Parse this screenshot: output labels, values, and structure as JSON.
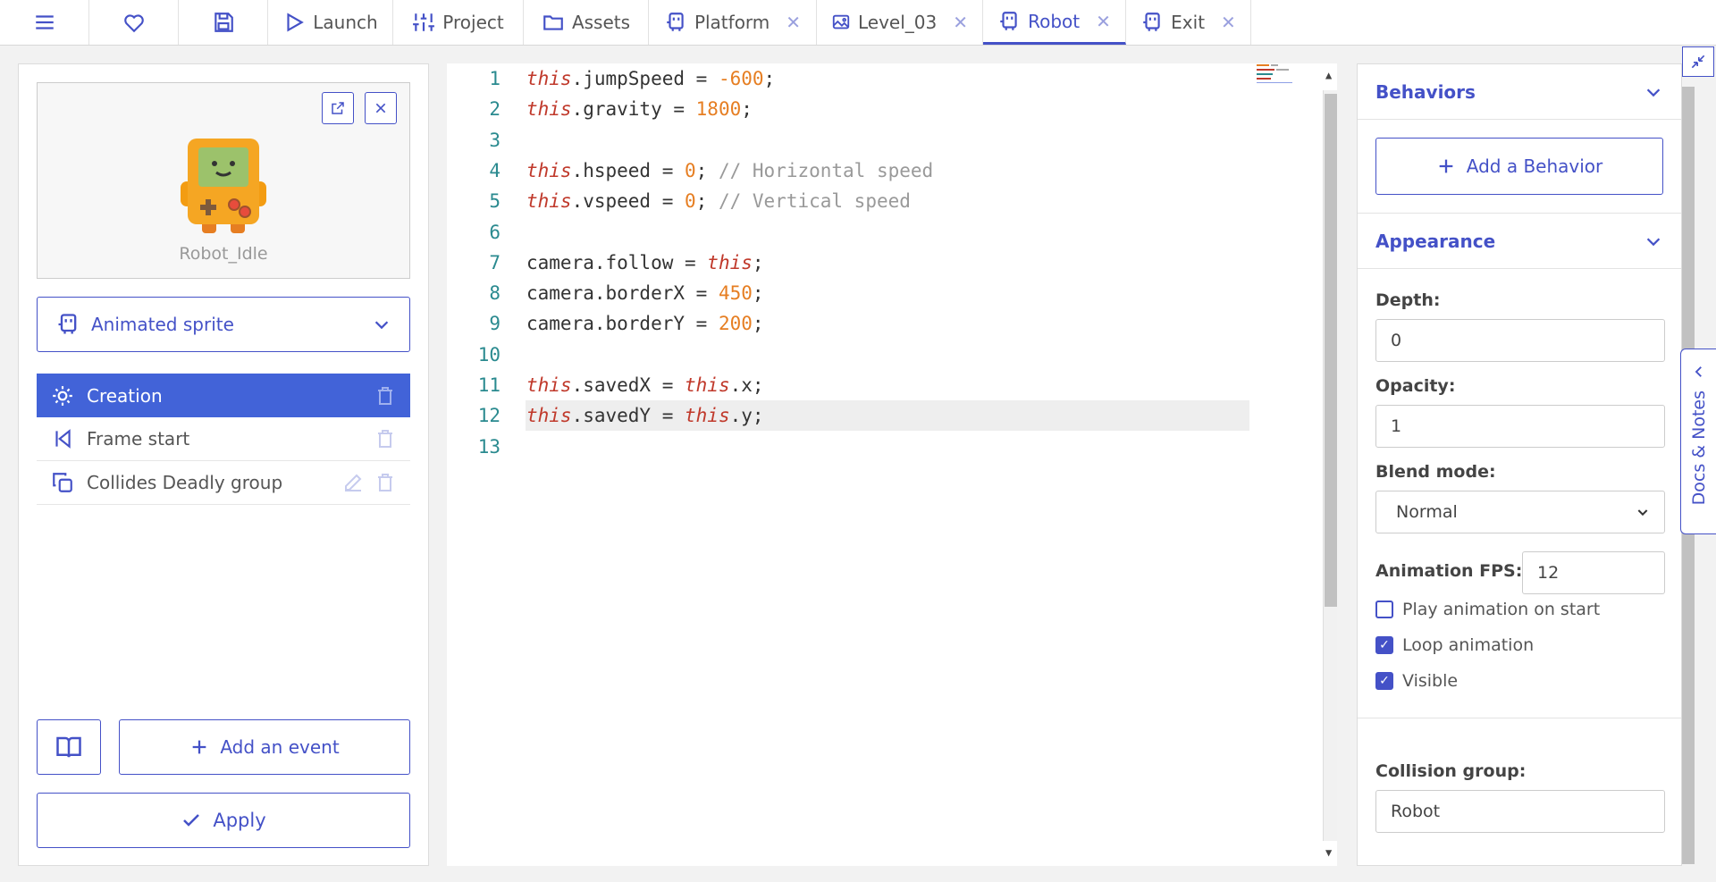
{
  "toolbar": {
    "menu_icon": "hamburger-icon",
    "favorite_icon": "heart-icon",
    "save_icon": "floppy-icon",
    "launch_label": "Launch",
    "project_label": "Project",
    "assets_label": "Assets",
    "tabs": [
      {
        "label": "Platform",
        "icon": "robot-icon",
        "closable": true
      },
      {
        "label": "Level_03",
        "icon": "image-icon",
        "closable": true
      },
      {
        "label": "Robot",
        "icon": "robot-icon",
        "closable": true,
        "active": true
      },
      {
        "label": "Exit",
        "icon": "robot-icon",
        "closable": true
      }
    ]
  },
  "left": {
    "sprite_name": "Robot_Idle",
    "template_select": "Animated sprite",
    "events": [
      {
        "label": "Creation",
        "icon": "sun-icon",
        "selected": true
      },
      {
        "label": "Frame start",
        "icon": "skip-back-icon",
        "selected": false
      },
      {
        "label": "Collides Deadly group",
        "icon": "copy-icon",
        "selected": false
      }
    ],
    "add_event_label": "Add an event",
    "apply_label": "Apply"
  },
  "editor": {
    "current_line": 12,
    "lines": [
      "this.jumpSpeed = -600;",
      "this.gravity = 1800;",
      "",
      "this.hspeed = 0; // Horizontal speed",
      "this.vspeed = 0; // Vertical speed",
      "",
      "camera.follow = this;",
      "camera.borderX = 450;",
      "camera.borderY = 200;",
      "",
      "this.savedX = this.x;",
      "this.savedY = this.y;",
      ""
    ]
  },
  "right": {
    "behaviors_title": "Behaviors",
    "add_behavior_label": "Add a Behavior",
    "appearance_title": "Appearance",
    "depth_label": "Depth:",
    "depth_value": "0",
    "opacity_label": "Opacity:",
    "opacity_value": "1",
    "blend_label": "Blend mode:",
    "blend_value": "Normal",
    "fps_label": "Animation FPS:",
    "fps_value": "12",
    "play_on_start_label": "Play animation on start",
    "play_on_start": false,
    "loop_label": "Loop animation",
    "loop": true,
    "visible_label": "Visible",
    "visible": true,
    "collision_label": "Collision group:",
    "collision_value": "Robot"
  },
  "docs_tab_label": "Docs & Notes",
  "colors": {
    "accent": "#4451c7",
    "selected_event": "#4263d8"
  }
}
